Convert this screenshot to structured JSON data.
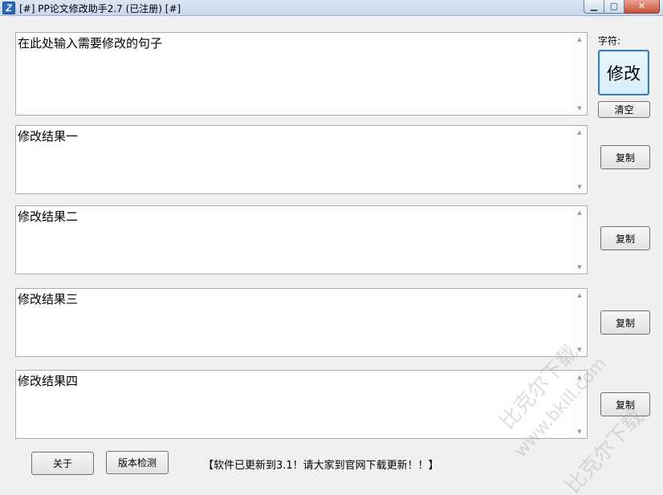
{
  "window": {
    "title": "[#] PP论文修改助手2.7 (已注册) [#]",
    "icon": "app-logo-icon",
    "minimize_glyph": "▁",
    "maximize_glyph": "▢",
    "close_glyph": "✕"
  },
  "input": {
    "placeholder_text": "在此处输入需要修改的句子"
  },
  "results": [
    {
      "text": "修改结果一",
      "copy_label": "复制"
    },
    {
      "text": "修改结果二",
      "copy_label": "复制"
    },
    {
      "text": "修改结果三",
      "copy_label": "复制"
    },
    {
      "text": "修改结果四",
      "copy_label": "复制"
    }
  ],
  "side": {
    "char_label": "字符:",
    "modify_label": "修改",
    "clear_label": "清空"
  },
  "footer": {
    "about_label": "关于",
    "version_check_label": "版本检测",
    "notice": "【软件已更新到3.1！请大家到官网下载更新！！】"
  },
  "watermark": {
    "line1": "比克尔下载",
    "line2": "www.bkill.com",
    "line3": "比克尔下载"
  },
  "scroll": {
    "up": "▲",
    "down": "▼"
  }
}
